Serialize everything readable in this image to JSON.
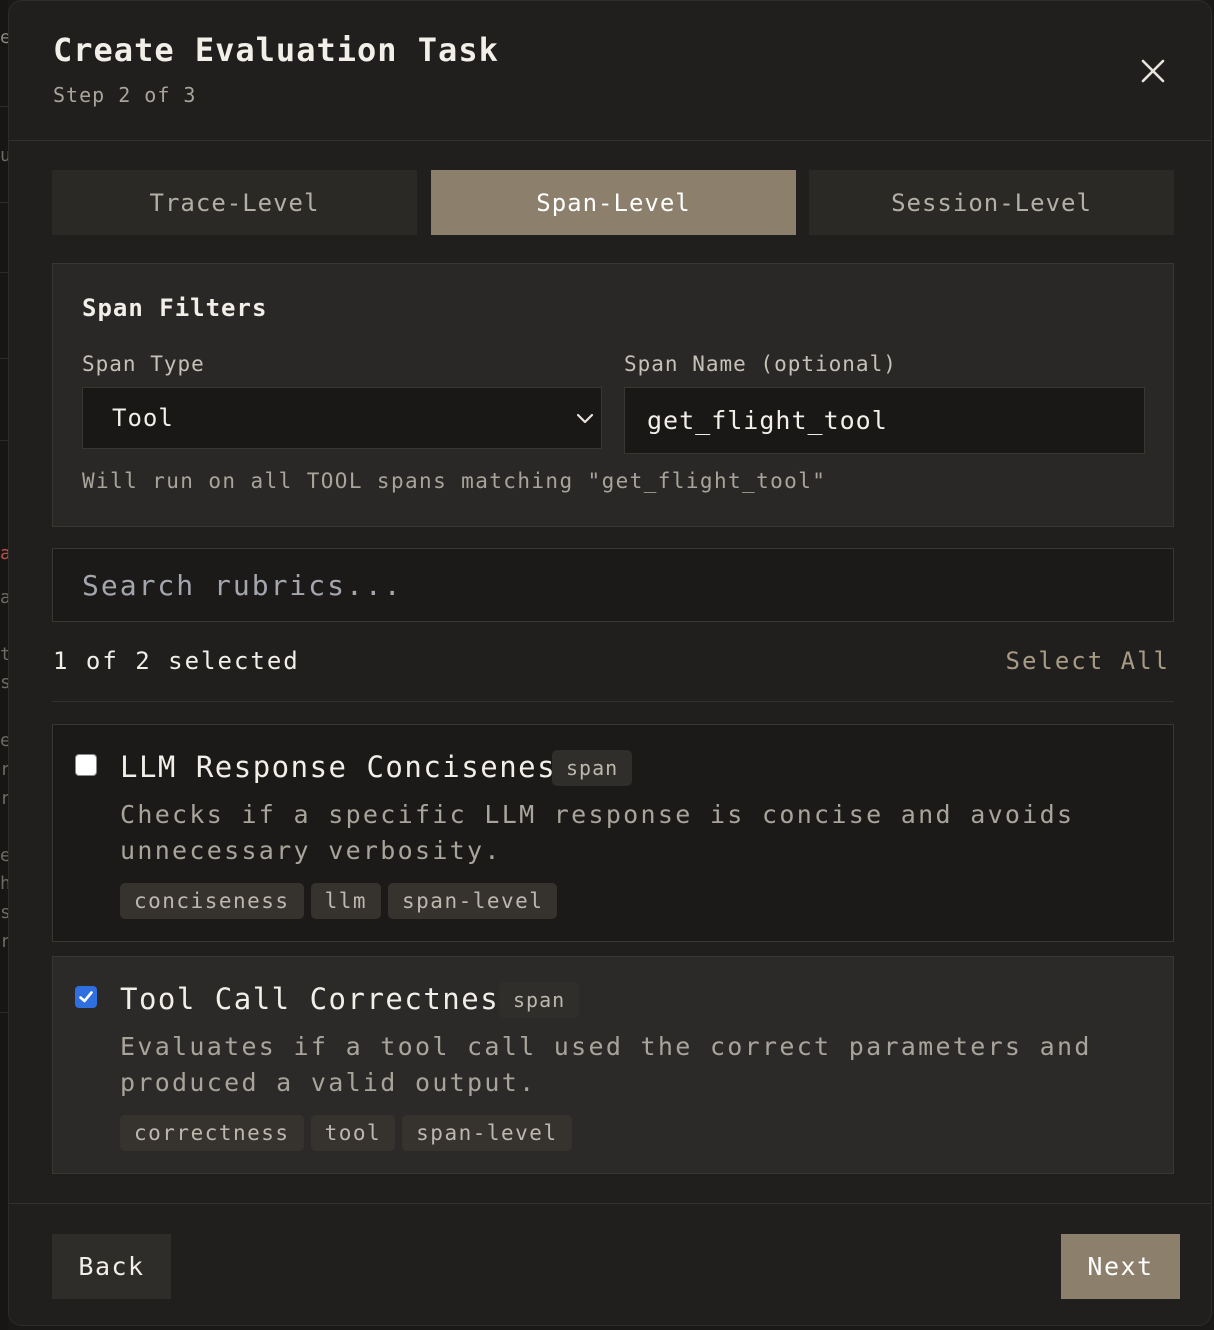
{
  "backdrop": {
    "glyphs": [
      "e",
      "u",
      "a",
      "a",
      "t",
      "s",
      "e",
      "r",
      "r",
      "e",
      "h",
      "s",
      "r"
    ]
  },
  "header": {
    "title": "Create Evaluation Task",
    "subtitle": "Step 2 of 3"
  },
  "tabs": [
    {
      "label": "Trace-Level",
      "active": false
    },
    {
      "label": "Span-Level",
      "active": true
    },
    {
      "label": "Session-Level",
      "active": false
    }
  ],
  "filters": {
    "title": "Span Filters",
    "span_type_label": "Span Type",
    "span_type_value": "Tool",
    "span_name_label": "Span Name (optional)",
    "span_name_value": "get_flight_tool",
    "hint": "Will run on all TOOL spans matching \"get_flight_tool\""
  },
  "search": {
    "placeholder": "Search rubrics..."
  },
  "selection": {
    "count_text": "1 of 2 selected",
    "select_all_label": "Select All"
  },
  "rubrics": [
    {
      "title": "LLM Response Conciseness",
      "badge": "span",
      "description": "Checks if a specific LLM response is concise and avoids unnecessary verbosity.",
      "tags": [
        "conciseness",
        "llm",
        "span-level"
      ],
      "checked": false
    },
    {
      "title": "Tool Call Correctness",
      "badge": "span",
      "description": "Evaluates if a tool call used the correct parameters and produced a valid output.",
      "tags": [
        "correctness",
        "tool",
        "span-level"
      ],
      "checked": true
    }
  ],
  "footer": {
    "back_label": "Back",
    "next_label": "Next"
  },
  "colors": {
    "accent": "#8c806d",
    "checkbox_checked": "#2f6fe0",
    "background": "#201f1d"
  }
}
